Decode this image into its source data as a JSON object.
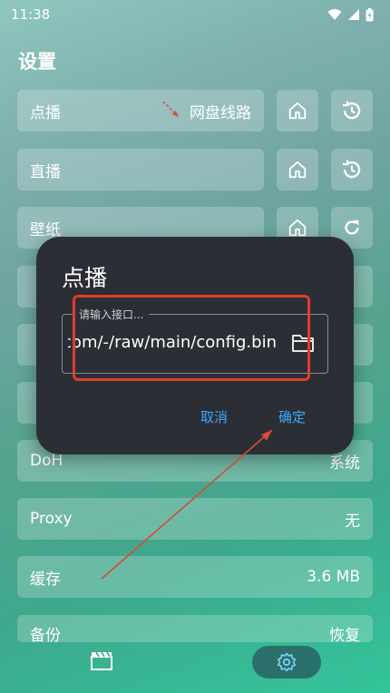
{
  "status": {
    "time": "11:38"
  },
  "page": {
    "title": "设置"
  },
  "rows": {
    "vod": {
      "label": "点播",
      "value": "网盘线路"
    },
    "live": {
      "label": "直播"
    },
    "wallpaper": {
      "label": "壁纸"
    },
    "doh": {
      "label": "DoH",
      "value": "系统"
    },
    "proxy": {
      "label": "Proxy",
      "value": "无"
    },
    "cache": {
      "label": "缓存",
      "value": "3.6 MB"
    },
    "backup": {
      "label": "备份",
      "value": "恢复"
    }
  },
  "dialog": {
    "title": "点播",
    "field_label": "请输入接口...",
    "field_value": "https://github.com/-/raw/main/config.bin",
    "cancel": "取消",
    "confirm": "确定"
  },
  "colors": {
    "dialog_bg": "#2c2e35",
    "accent": "#3da8ff",
    "highlight": "#e03b2b",
    "nav_active": "#2b6f6a"
  }
}
